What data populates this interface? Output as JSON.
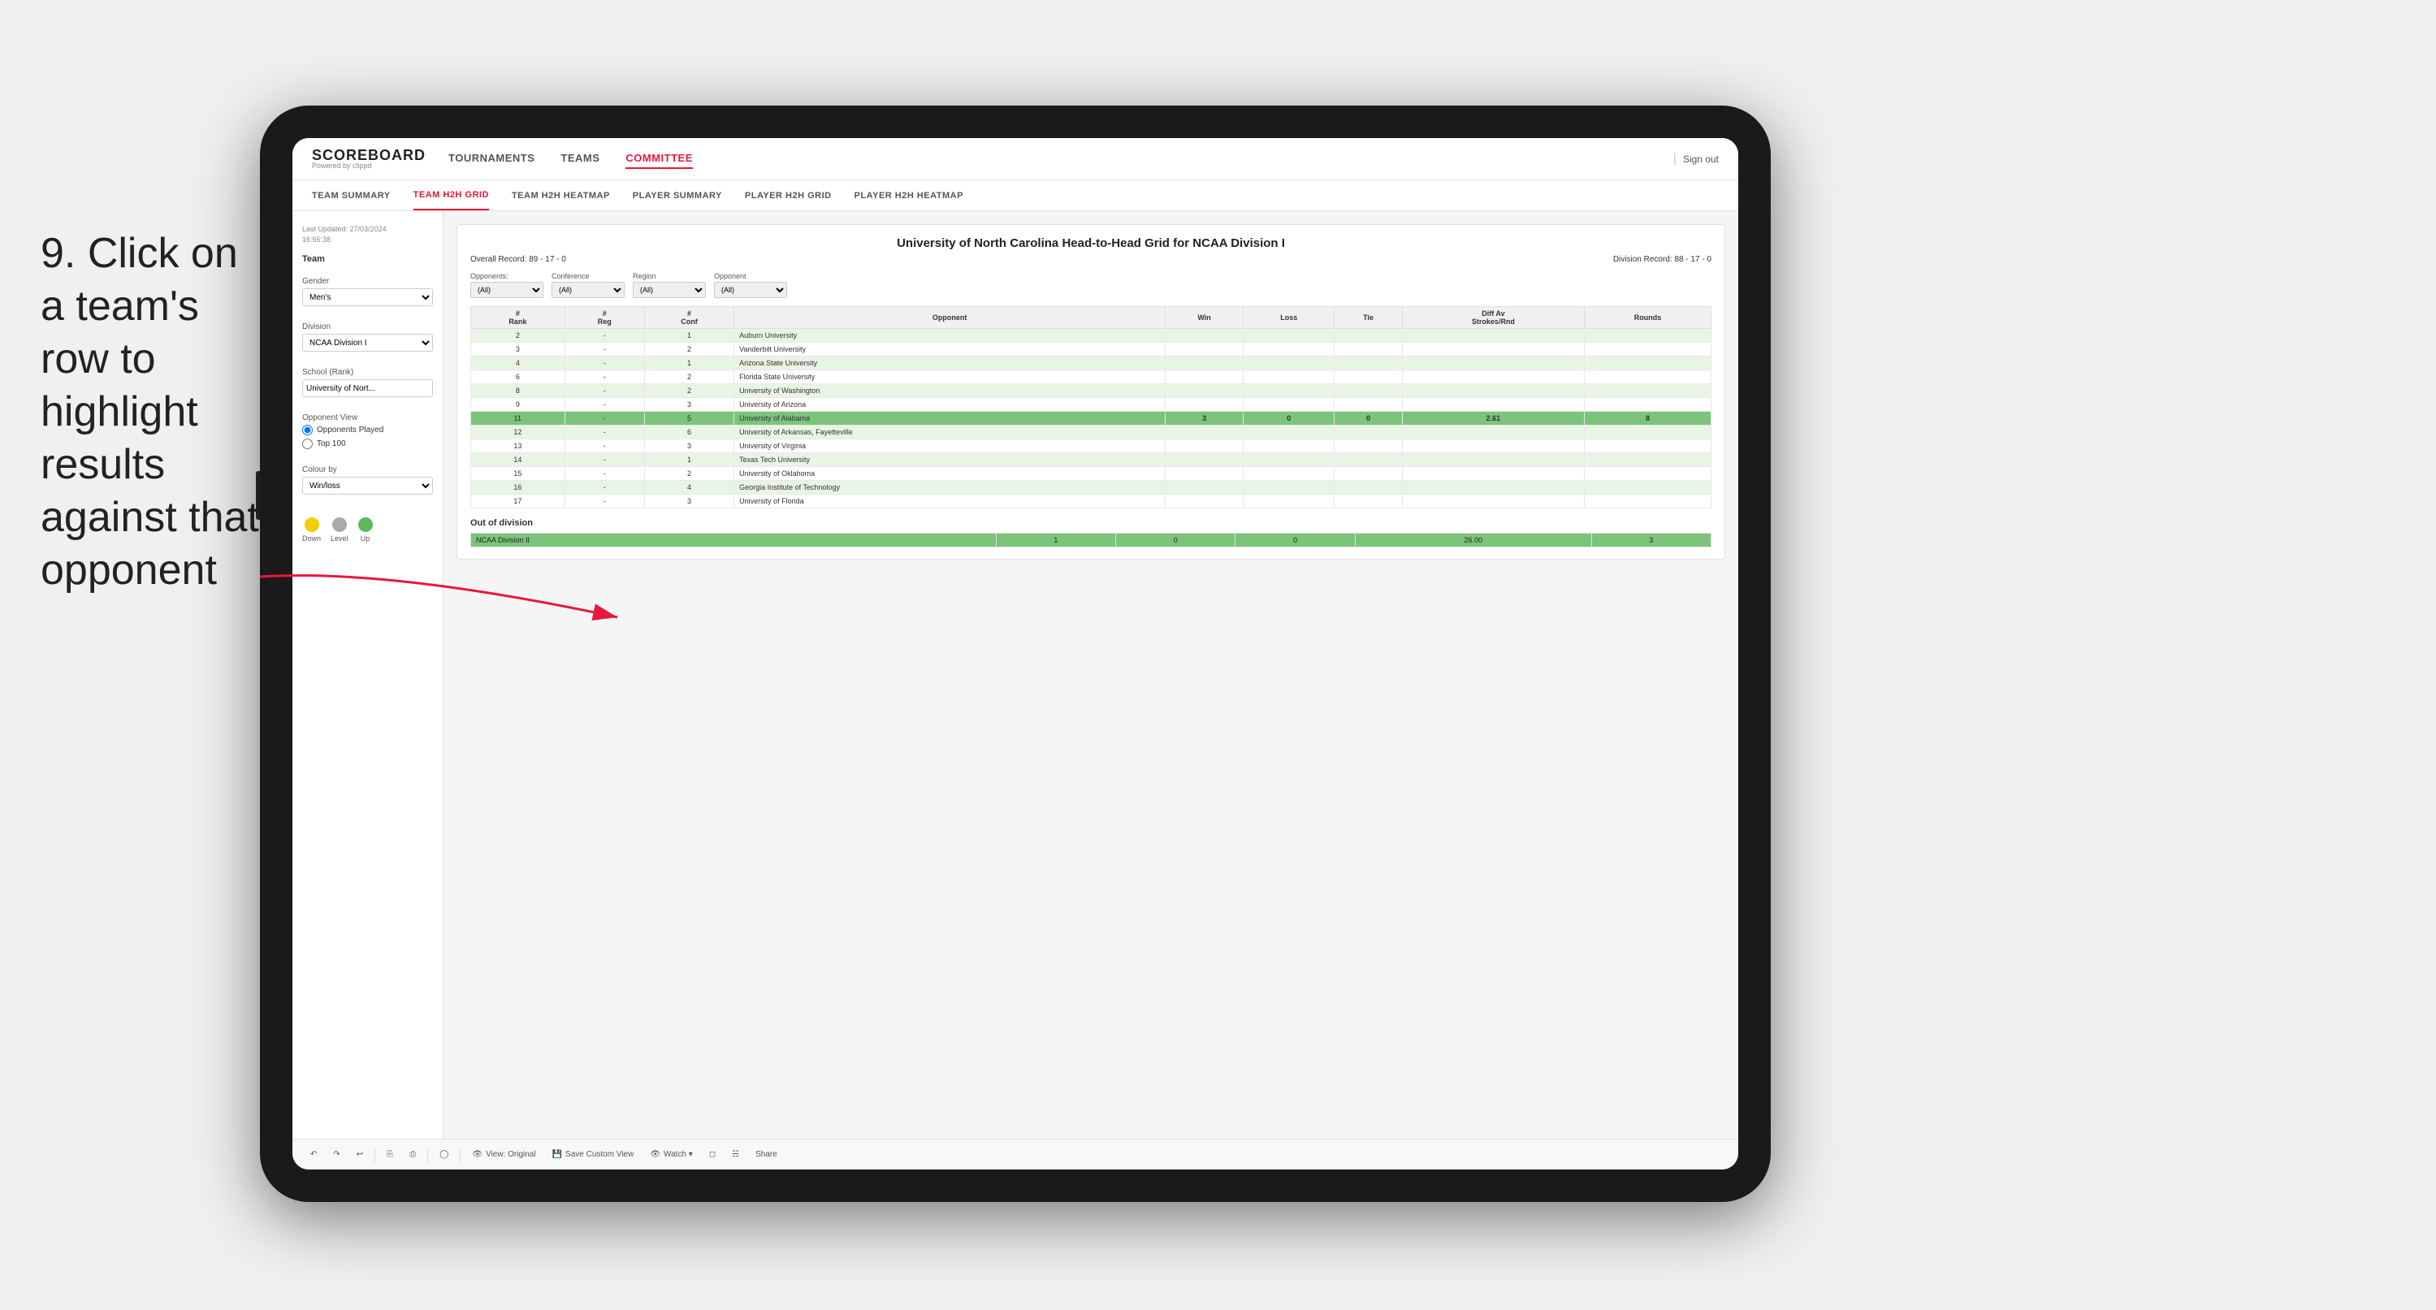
{
  "instruction": {
    "step": "9.",
    "text": "Click on a team's row to highlight results against that opponent"
  },
  "nav": {
    "logo_main": "SCOREBOARD",
    "logo_sub": "Powered by clippd",
    "items": [
      "TOURNAMENTS",
      "TEAMS",
      "COMMITTEE"
    ],
    "active_item": "COMMITTEE",
    "sign_out": "Sign out"
  },
  "sub_nav": {
    "items": [
      "TEAM SUMMARY",
      "TEAM H2H GRID",
      "TEAM H2H HEATMAP",
      "PLAYER SUMMARY",
      "PLAYER H2H GRID",
      "PLAYER H2H HEATMAP"
    ],
    "active_item": "TEAM H2H GRID"
  },
  "sidebar": {
    "timestamp_label": "Last Updated: 27/03/2024",
    "timestamp_time": "16:55:38",
    "team_label": "Team",
    "gender_label": "Gender",
    "gender_value": "Men's",
    "division_label": "Division",
    "division_value": "NCAA Division I",
    "school_label": "School (Rank)",
    "school_value": "University of Nort...",
    "opponent_view_label": "Opponent View",
    "radio_opponents": "Opponents Played",
    "radio_top100": "Top 100",
    "colour_label": "Colour by",
    "colour_value": "Win/loss",
    "legend_down": "Down",
    "legend_level": "Level",
    "legend_up": "Up"
  },
  "grid": {
    "title": "University of North Carolina Head-to-Head Grid for NCAA Division I",
    "overall_record": "Overall Record: 89 - 17 - 0",
    "division_record": "Division Record: 88 - 17 - 0",
    "opponents_label": "Opponents:",
    "opponents_value": "(All)",
    "conference_label": "Conference",
    "conference_value": "(All)",
    "region_label": "Region",
    "region_value": "(All)",
    "opponent_label": "Opponent",
    "opponent_value": "(All)",
    "col_rank": "#\nRank",
    "col_reg": "#\nReg",
    "col_conf": "#\nConf",
    "col_opponent": "Opponent",
    "col_win": "Win",
    "col_loss": "Loss",
    "col_tie": "Tie",
    "col_diff": "Diff Av\nStrokes/Rnd",
    "col_rounds": "Rounds",
    "rows": [
      {
        "rank": "2",
        "reg": "-",
        "conf": "1",
        "opponent": "Auburn University",
        "win": "",
        "loss": "",
        "tie": "",
        "diff": "",
        "rounds": "",
        "highlight": "light"
      },
      {
        "rank": "3",
        "reg": "-",
        "conf": "2",
        "opponent": "Vanderbilt University",
        "win": "",
        "loss": "",
        "tie": "",
        "diff": "",
        "rounds": "",
        "highlight": "none"
      },
      {
        "rank": "4",
        "reg": "-",
        "conf": "1",
        "opponent": "Arizona State University",
        "win": "",
        "loss": "",
        "tie": "",
        "diff": "",
        "rounds": "",
        "highlight": "light"
      },
      {
        "rank": "6",
        "reg": "-",
        "conf": "2",
        "opponent": "Florida State University",
        "win": "",
        "loss": "",
        "tie": "",
        "diff": "",
        "rounds": "",
        "highlight": "none"
      },
      {
        "rank": "8",
        "reg": "-",
        "conf": "2",
        "opponent": "University of Washington",
        "win": "",
        "loss": "",
        "tie": "",
        "diff": "",
        "rounds": "",
        "highlight": "light"
      },
      {
        "rank": "9",
        "reg": "-",
        "conf": "3",
        "opponent": "University of Arizona",
        "win": "",
        "loss": "",
        "tie": "",
        "diff": "",
        "rounds": "",
        "highlight": "none"
      },
      {
        "rank": "11",
        "reg": "-",
        "conf": "5",
        "opponent": "University of Alabama",
        "win": "3",
        "loss": "0",
        "tie": "0",
        "diff": "2.61",
        "rounds": "8",
        "highlight": "selected"
      },
      {
        "rank": "12",
        "reg": "-",
        "conf": "6",
        "opponent": "University of Arkansas, Fayetteville",
        "win": "",
        "loss": "",
        "tie": "",
        "diff": "",
        "rounds": "",
        "highlight": "light"
      },
      {
        "rank": "13",
        "reg": "-",
        "conf": "3",
        "opponent": "University of Virginia",
        "win": "",
        "loss": "",
        "tie": "",
        "diff": "",
        "rounds": "",
        "highlight": "none"
      },
      {
        "rank": "14",
        "reg": "-",
        "conf": "1",
        "opponent": "Texas Tech University",
        "win": "",
        "loss": "",
        "tie": "",
        "diff": "",
        "rounds": "",
        "highlight": "light"
      },
      {
        "rank": "15",
        "reg": "-",
        "conf": "2",
        "opponent": "University of Oklahoma",
        "win": "",
        "loss": "",
        "tie": "",
        "diff": "",
        "rounds": "",
        "highlight": "none"
      },
      {
        "rank": "16",
        "reg": "-",
        "conf": "4",
        "opponent": "Georgia Institute of Technology",
        "win": "",
        "loss": "",
        "tie": "",
        "diff": "",
        "rounds": "",
        "highlight": "light"
      },
      {
        "rank": "17",
        "reg": "-",
        "conf": "3",
        "opponent": "University of Florida",
        "win": "",
        "loss": "",
        "tie": "",
        "diff": "",
        "rounds": "",
        "highlight": "none"
      }
    ],
    "out_of_division_label": "Out of division",
    "out_div_rows": [
      {
        "label": "NCAA Division II",
        "win": "1",
        "loss": "0",
        "tie": "0",
        "diff": "26.00",
        "rounds": "3",
        "highlight": "green"
      }
    ]
  },
  "toolbar": {
    "view_original": "View: Original",
    "save_custom": "Save Custom View",
    "watch": "Watch ▾",
    "share": "Share"
  },
  "colors": {
    "accent_red": "#e8173b",
    "highlight_green_dark": "#7bc47a",
    "highlight_green_light": "#e8f5e4",
    "highlight_yellow": "#fff8cc",
    "legend_down": "#f0d000",
    "legend_level": "#aaaaaa",
    "legend_up": "#5cb85c"
  }
}
